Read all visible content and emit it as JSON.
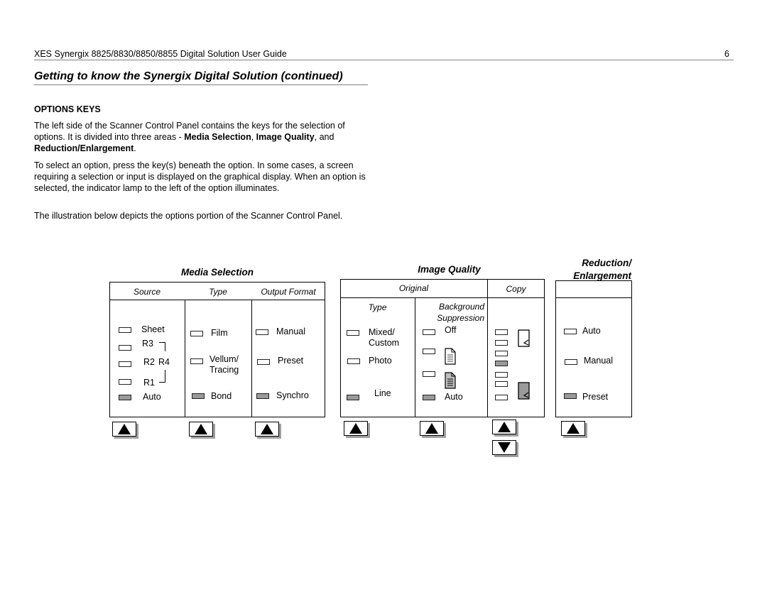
{
  "header": {
    "doc_title": "XES Synergix 8825/8830/8850/8855 Digital Solution User Guide",
    "page_number": "6"
  },
  "section": {
    "title": "Getting to know the Synergix Digital Solution (continued)",
    "subheading": "OPTIONS KEYS",
    "para1": {
      "text_a": "The left side of the Scanner Control Panel contains the keys for the selection of options.  It is divided into three areas - ",
      "bold_1": "Media Selection",
      "sep_1": ", ",
      "bold_2": "Image Quality",
      "sep_2": ", and ",
      "bold_3": "Reduction/Enlargement",
      "end": "."
    },
    "para2": "To select an option, press the key(s) beneath the option.  In some cases, a screen requiring a selection or input is displayed on the graphical display. When an option is selected, the indicator lamp to the left of the option illuminates.",
    "para3": "The illustration below depicts the options portion of the Scanner Control Panel."
  },
  "panel": {
    "lamp_on_color": "#9a9a9a",
    "media_selection": {
      "title": "Media Selection",
      "columns": [
        "Source",
        "Type",
        "Output Format"
      ],
      "source": {
        "options": [
          {
            "label": "Sheet",
            "lit": false
          },
          {
            "label": "R3",
            "lit": false
          },
          {
            "label": "R2",
            "lit": false
          },
          {
            "label": "R1",
            "lit": false
          },
          {
            "label": "Auto",
            "lit": true
          }
        ],
        "group_label": "R4"
      },
      "type": {
        "options": [
          {
            "label": "Film",
            "lit": false
          },
          {
            "label": "Vellum/ Tracing",
            "lit": false
          },
          {
            "label": "Bond",
            "lit": true
          }
        ]
      },
      "output_format": {
        "options": [
          {
            "label": "Manual",
            "lit": false
          },
          {
            "label": "Preset",
            "lit": false
          },
          {
            "label": "Synchro",
            "lit": true
          }
        ]
      }
    },
    "image_quality": {
      "title": "Image Quality",
      "columns": [
        "Original",
        "Copy"
      ],
      "subcolumns": [
        "Type",
        "Background Suppression"
      ],
      "type": {
        "options": [
          {
            "label": "Mixed/ Custom",
            "lit": false
          },
          {
            "label": "Photo",
            "lit": false
          },
          {
            "label": "Line",
            "lit": true
          }
        ]
      },
      "background_suppression": {
        "options": [
          {
            "label": "Off",
            "lit": false,
            "icon": "none"
          },
          {
            "label": "",
            "lit": false,
            "icon": "document-light-icon"
          },
          {
            "label": "",
            "lit": false,
            "icon": "document-dark-icon"
          },
          {
            "label": "Auto",
            "lit": true,
            "icon": "none"
          }
        ]
      },
      "copy": {
        "lamps": [
          false,
          false,
          false,
          true,
          false,
          false,
          false
        ],
        "icons": [
          "page-light-icon",
          "page-dark-icon"
        ]
      }
    },
    "reduction_enlargement": {
      "title": "Reduction/ Enlargement",
      "options": [
        {
          "label": "Auto",
          "lit": false
        },
        {
          "label": "Manual",
          "lit": false
        },
        {
          "label": "Preset",
          "lit": true
        }
      ]
    }
  }
}
